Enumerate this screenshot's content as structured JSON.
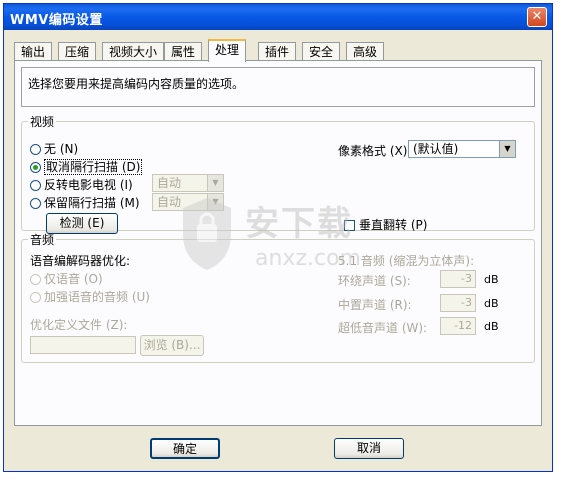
{
  "window": {
    "title": "WMV编码设置"
  },
  "tabs": [
    {
      "label": "输出"
    },
    {
      "label": "压缩"
    },
    {
      "label": "视频大小"
    },
    {
      "label": "属性"
    },
    {
      "label": "处理",
      "active": true
    },
    {
      "label": "插件"
    },
    {
      "label": "安全"
    },
    {
      "label": "高级"
    }
  ],
  "description": "选择您要用来提高编码内容质量的选项。",
  "video": {
    "legend": "视频",
    "options": [
      {
        "label": "无 (N)",
        "selected": false
      },
      {
        "label": "取消隔行扫描 (D)",
        "selected": true
      },
      {
        "label": "反转电影电视 (I)",
        "selected": false,
        "combo": "自动"
      },
      {
        "label": "保留隔行扫描 (M)",
        "selected": false,
        "combo": "自动"
      }
    ],
    "detect_button": "检测 (E)",
    "pixel_format_label": "像素格式 (X):",
    "pixel_format_value": "(默认值)",
    "vertical_flip_label": "垂直翻转 (P)"
  },
  "audio": {
    "legend": "音频",
    "codec_opt_label": "语音编解码器优化:",
    "options": [
      {
        "label": "仅语音 (O)"
      },
      {
        "label": "加强语音的音频 (U)"
      }
    ],
    "custom_file_label": "优化定义文件 (Z):",
    "custom_file_value": "",
    "browse_button": "浏览 (B)...",
    "surround_label": "5.1 音频 (缩混为立体声):",
    "channels": [
      {
        "label": "环绕声道 (S):",
        "value": "-3",
        "unit": "dB"
      },
      {
        "label": "中置声道 (R):",
        "value": "-3",
        "unit": "dB"
      },
      {
        "label": "超低音声道 (W):",
        "value": "-12",
        "unit": "dB"
      }
    ]
  },
  "buttons": {
    "ok": "确定",
    "cancel": "取消"
  },
  "watermark": {
    "cn": "安下载",
    "en": "anxz.com"
  }
}
